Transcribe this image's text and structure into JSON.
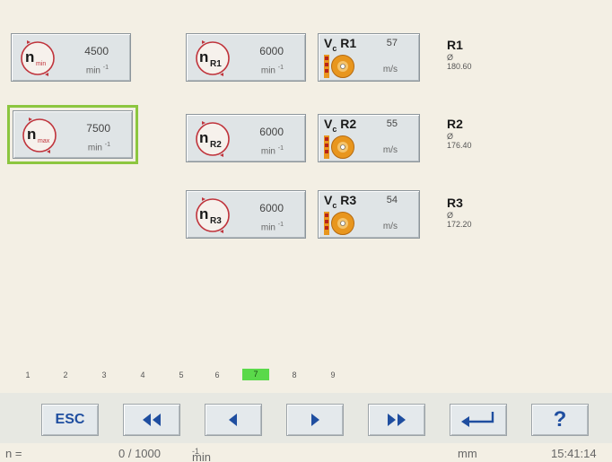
{
  "rpm_buttons": {
    "n_min": {
      "symbol": "n",
      "sub": "min",
      "value": "4500",
      "unit": "min",
      "unit_exp": "-1"
    },
    "n_max": {
      "symbol": "n",
      "sub": "max",
      "value": "7500",
      "unit": "min",
      "unit_exp": "-1"
    },
    "n_r1": {
      "symbol": "n",
      "sub": "R1",
      "value": "6000",
      "unit": "min",
      "unit_exp": "-1"
    },
    "n_r2": {
      "symbol": "n",
      "sub": "R2",
      "value": "6000",
      "unit": "min",
      "unit_exp": "-1"
    },
    "n_r3": {
      "symbol": "n",
      "sub": "R3",
      "value": "6000",
      "unit": "min",
      "unit_exp": "-1"
    }
  },
  "vc_buttons": [
    {
      "symbol": "V",
      "sub": "c",
      "name": "R1",
      "value": "57",
      "unit": "m/s"
    },
    {
      "symbol": "V",
      "sub": "c",
      "name": "R2",
      "value": "55",
      "unit": "m/s"
    },
    {
      "symbol": "V",
      "sub": "c",
      "name": "R3",
      "value": "54",
      "unit": "m/s"
    }
  ],
  "diameters": [
    {
      "name": "R1",
      "symbol": "Ø",
      "value": "180.60"
    },
    {
      "name": "R2",
      "symbol": "Ø",
      "value": "176.40"
    },
    {
      "name": "R3",
      "symbol": "Ø",
      "value": "172.20"
    }
  ],
  "pages": {
    "items": [
      "1",
      "2",
      "3",
      "4",
      "5",
      "6",
      "7",
      "8",
      "9"
    ],
    "active": "7"
  },
  "nav": {
    "esc_label": "ESC",
    "help_label": "?"
  },
  "status": {
    "n_label": "n =",
    "count": "0 / 1000",
    "unit": "min",
    "unit_exp": "-1",
    "mm": "mm",
    "time": "15:41:14"
  },
  "colors": {
    "background": "#f3efe4",
    "button": "#dfe4e6",
    "selected_outline": "#8cc63f",
    "active_page": "#5ad94a",
    "nav_icon": "#1f4ea0",
    "dial_red": "#c0343c",
    "blade_orange": "#e8961e"
  },
  "icons": {
    "dial": "rotation-dial-icon",
    "blade": "saw-blade-icon",
    "rewind": "fast-backward-icon",
    "back": "step-backward-icon",
    "forward": "step-forward-icon",
    "fast_forward": "fast-forward-icon",
    "enter": "enter-return-icon"
  }
}
